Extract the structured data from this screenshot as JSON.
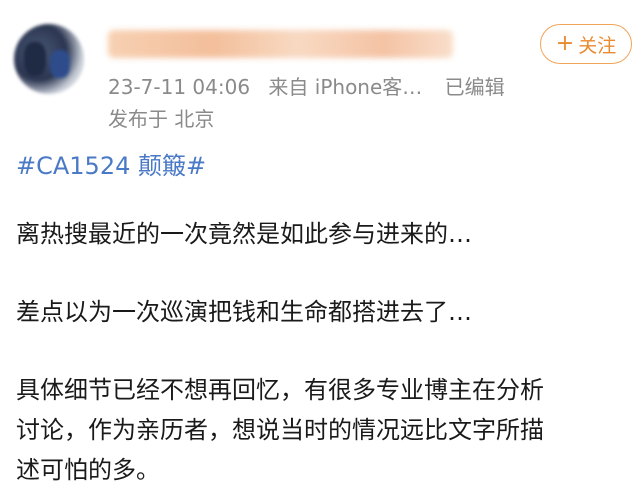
{
  "post": {
    "author": {
      "name": "",
      "avatar_icon": "avatar-icon"
    },
    "follow_label": "关注",
    "follow_plus": "+",
    "meta": {
      "timestamp": "23-7-11 04:06",
      "source": "来自 iPhone客…",
      "edited": "已编辑"
    },
    "location": "发布于 北京",
    "hashtag": "#CA1524 颠簸#",
    "paragraphs": [
      [
        "离热搜最近的一次竟然是如此参与进来的…"
      ],
      [
        "差点以为一次巡演把钱和生命都搭进去了…"
      ],
      [
        "具体细节已经不想再回忆，有很多专业博主在分析",
        "讨论，作为亲历者，想说当时的情况远比文字所描",
        "述可怕的多。"
      ]
    ]
  },
  "colors": {
    "accent": "#e98a2f",
    "hashtag": "#4a79c6",
    "meta": "#8a8a8a"
  }
}
